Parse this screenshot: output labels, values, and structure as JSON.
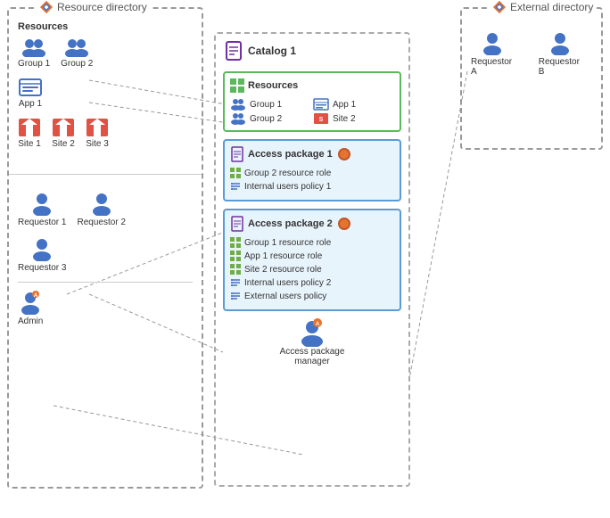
{
  "resourceDirectory": {
    "label": "Resource directory",
    "resources": {
      "label": "Resources",
      "items": [
        {
          "name": "Group 1",
          "type": "group"
        },
        {
          "name": "Group 2",
          "type": "group"
        },
        {
          "name": "App 1",
          "type": "app"
        },
        {
          "name": "Site 1",
          "type": "site"
        },
        {
          "name": "Site 2",
          "type": "site"
        },
        {
          "name": "Site 3",
          "type": "site"
        }
      ]
    },
    "requestors": [
      {
        "name": "Requestor 1"
      },
      {
        "name": "Requestor 2"
      },
      {
        "name": "Requestor 3"
      }
    ],
    "admin": {
      "name": "Admin"
    }
  },
  "catalog": {
    "label": "Catalog 1",
    "resources": {
      "label": "Resources",
      "items": [
        {
          "name": "Group 1",
          "type": "group"
        },
        {
          "name": "App 1",
          "type": "app"
        },
        {
          "name": "Group 2",
          "type": "group"
        },
        {
          "name": "Site 2",
          "type": "site"
        }
      ]
    },
    "accessPackages": [
      {
        "label": "Access package 1",
        "items": [
          {
            "text": "Group 2 resource role",
            "type": "resource"
          },
          {
            "text": "Internal users policy 1",
            "type": "policy"
          }
        ]
      },
      {
        "label": "Access package 2",
        "items": [
          {
            "text": "Group 1 resource role",
            "type": "resource"
          },
          {
            "text": "App 1 resource role",
            "type": "resource"
          },
          {
            "text": "Site 2 resource role",
            "type": "resource"
          },
          {
            "text": "Internal users policy 2",
            "type": "policy"
          },
          {
            "text": "External users policy",
            "type": "policy"
          }
        ]
      }
    ]
  },
  "externalDirectory": {
    "label": "External directory",
    "requestors": [
      {
        "name": "Requestor A"
      },
      {
        "name": "Requestor B"
      }
    ]
  },
  "accessPackageManager": {
    "label": "Access package\nmanager"
  },
  "icons": {
    "diamond": "◇",
    "grid": "⊞",
    "policy": "☰",
    "person": "👤",
    "catalog": "📋"
  }
}
